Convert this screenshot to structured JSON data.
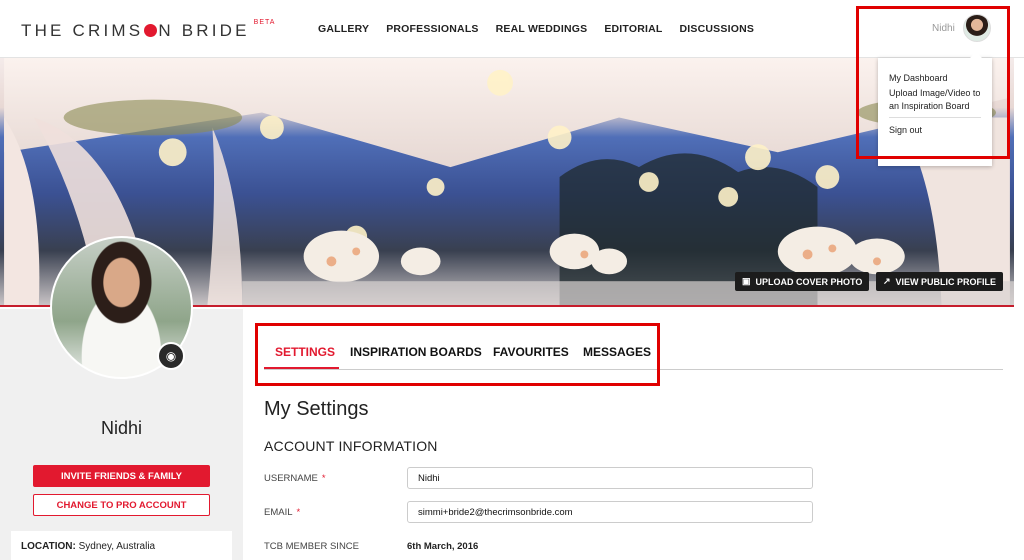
{
  "header": {
    "logo_text": "THE CRIMS",
    "logo_text_end": "N BRIDE",
    "logo_badge": "BETA",
    "nav": [
      "GALLERY",
      "PROFESSIONALS",
      "REAL WEDDINGS",
      "EDITORIAL",
      "DISCUSSIONS"
    ],
    "user_name": "Nidhi"
  },
  "user_menu": {
    "items": [
      "My Dashboard",
      "Upload Image/Video to an Inspiration Board"
    ],
    "sign_out": "Sign out"
  },
  "hero": {
    "upload_cover_label": "UPLOAD COVER PHOTO",
    "view_profile_label": "VIEW PUBLIC PROFILE"
  },
  "profile": {
    "name": "Nidhi",
    "invite_label": "INVITE FRIENDS & FAMILY",
    "pro_label": "CHANGE TO PRO ACCOUNT",
    "location_label": "LOCATION:",
    "location_value": "Sydney, Australia"
  },
  "tabs": [
    "SETTINGS",
    "INSPIRATION BOARDS",
    "FAVOURITES",
    "MESSAGES"
  ],
  "settings": {
    "title": "My Settings",
    "section": "ACCOUNT INFORMATION",
    "username_label": "USERNAME",
    "username_value": "Nidhi",
    "email_label": "EMAIL",
    "email_value": "simmi+bride2@thecrimsonbride.com",
    "member_since_label": "TCB MEMBER SINCE",
    "member_since_value": "6th March, 2016",
    "required_mark": "*"
  },
  "colors": {
    "accent": "#e2192f",
    "annotation": "#e00000"
  },
  "icons": {
    "upload_cover": "image-icon",
    "view_profile": "external-link-icon",
    "camera": "camera-icon"
  }
}
